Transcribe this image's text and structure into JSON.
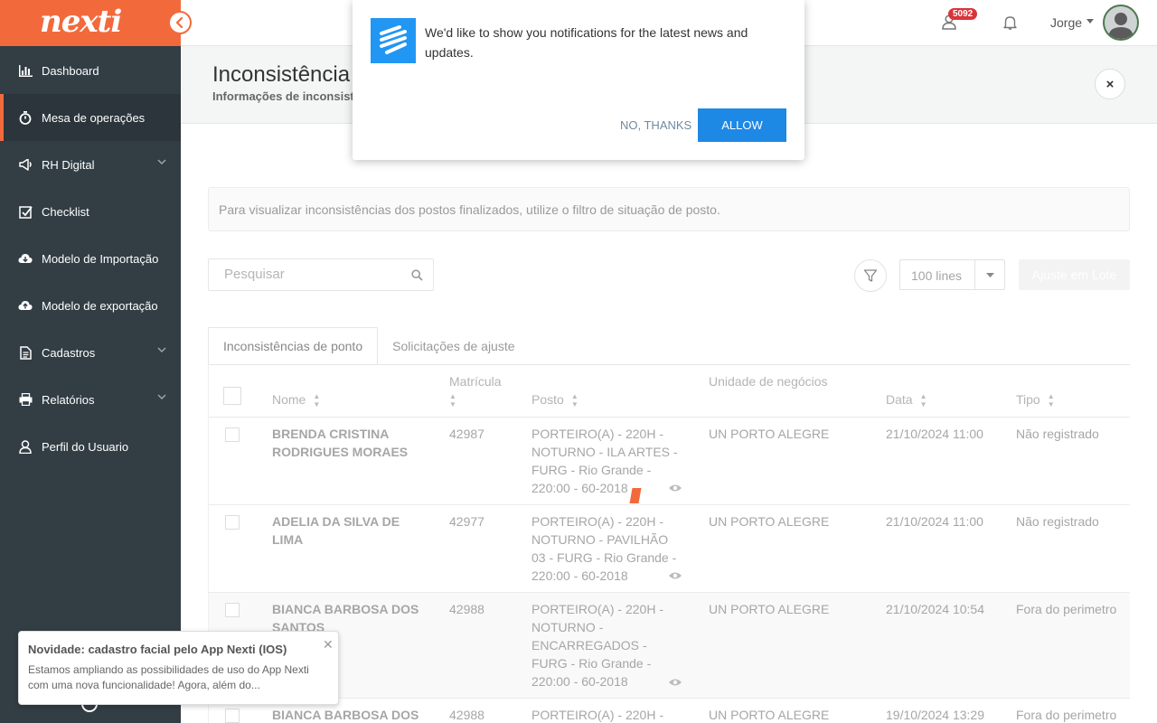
{
  "brand": {
    "logo": "nexti",
    "accent": "#f26a3c"
  },
  "sidebar": {
    "items": [
      {
        "label": "Dashboard",
        "icon": "chart-icon"
      },
      {
        "label": "Mesa de operações",
        "icon": "stopwatch-icon",
        "active": true
      },
      {
        "label": "RH Digital",
        "icon": "megaphone-icon",
        "has_chevron": true
      },
      {
        "label": "Checklist",
        "icon": "checklist-icon"
      },
      {
        "label": "Modelo de Importação",
        "icon": "cloud-download-icon"
      },
      {
        "label": "Modelo de exportação",
        "icon": "cloud-upload-icon"
      },
      {
        "label": "Cadastros",
        "icon": "document-icon",
        "has_chevron": true
      },
      {
        "label": "Relatórios",
        "icon": "printer-icon",
        "has_chevron": true
      },
      {
        "label": "Perfil do Usuario",
        "icon": "user-icon"
      }
    ]
  },
  "topbar": {
    "badge": "5092",
    "user_name": "Jorge"
  },
  "header": {
    "title": "Inconsistência",
    "subtitle": "Informações de inconsistê",
    "close": "×"
  },
  "info": {
    "text": "Para visualizar inconsistências dos postos finalizados, utilize o filtro de situação de posto."
  },
  "toolbar": {
    "search_placeholder": "Pesquisar",
    "lines": "100 lines",
    "lote_button": "Ajuste em Lote"
  },
  "tabs": [
    {
      "label": "Inconsistências de ponto",
      "active": true
    },
    {
      "label": "Solicitações de ajuste"
    }
  ],
  "table": {
    "columns": {
      "nome": "Nome",
      "matricula": "Matrícula",
      "posto": "Posto",
      "unidade": "Unidade de negócios",
      "data": "Data",
      "tipo": "Tipo"
    },
    "rows": [
      {
        "nome": "BRENDA CRISTINA RODRIGUES MORAES",
        "matricula": "42987",
        "posto": "PORTEIRO(A) - 220H - NOTURNO - ILA ARTES - FURG - Rio Grande - 220:00 - 60-2018",
        "unidade": "UN PORTO ALEGRE",
        "data": "21/10/2024 11:00",
        "tipo": "Não registrado"
      },
      {
        "nome": "ADELIA DA SILVA DE LIMA",
        "matricula": "42977",
        "posto": "PORTEIRO(A) - 220H - NOTURNO - PAVILHÃO 03 - FURG - Rio Grande - 220:00 - 60-2018",
        "unidade": "UN PORTO ALEGRE",
        "data": "21/10/2024 11:00",
        "tipo": "Não registrado"
      },
      {
        "nome": "BIANCA BARBOSA DOS SANTOS",
        "matricula": "42988",
        "posto": "PORTEIRO(A) - 220H - NOTURNO - ENCARREGADOS - FURG - Rio Grande - 220:00 - 60-2018",
        "unidade": "UN PORTO ALEGRE",
        "data": "21/10/2024 10:54",
        "tipo": "Fora do perimetro"
      },
      {
        "nome": "BIANCA BARBOSA DOS",
        "matricula": "42988",
        "posto": "PORTEIRO(A) - 220H -",
        "unidade": "UN PORTO ALEGRE",
        "data": "19/10/2024 13:29",
        "tipo": "Fora do perimetro"
      }
    ]
  },
  "notification": {
    "text": "We'd like to show you notifications for the latest news and updates.",
    "no": "NO, THANKS",
    "allow": "ALLOW"
  },
  "toast": {
    "title": "Novidade: cadastro facial pelo App Nexti (IOS)",
    "body": "Estamos ampliando as possibilidades de uso do App Nexti com uma nova funcionalidade! Agora, além do..."
  }
}
